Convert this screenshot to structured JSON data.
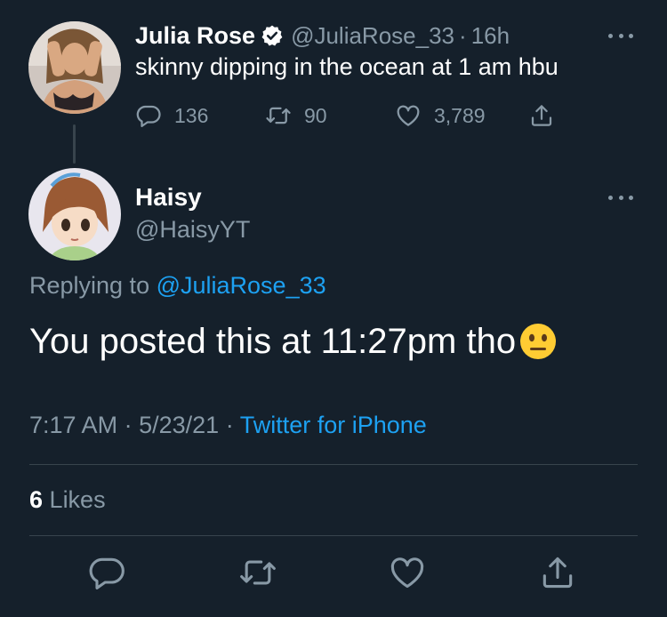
{
  "original_tweet": {
    "name": "Julia Rose",
    "handle": "@JuliaRose_33",
    "separator": "·",
    "time": "16h",
    "text": "skinny dipping in the ocean at 1 am hbu",
    "reply_count": "136",
    "retweet_count": "90",
    "like_count": "3,789",
    "verified_icon": "verified-badge-icon"
  },
  "reply_tweet": {
    "name": "Haisy",
    "handle": "@HaisyYT",
    "replying_prefix": "Replying to",
    "replying_mention": "@JuliaRose_33",
    "text": "You posted this at 11:27pm tho",
    "emoji": "neutral-face-emoji",
    "timestamp": "7:17 AM",
    "separator": "·",
    "date": "5/23/21",
    "source": "Twitter for iPhone",
    "likes_count": "6",
    "likes_label": "Likes"
  },
  "colors": {
    "background": "#15202b",
    "text_primary": "#ffffff",
    "text_secondary": "#8899a6",
    "accent": "#1da1f2",
    "divider": "#38444d"
  },
  "icons": {
    "reply": "reply-icon",
    "retweet": "retweet-icon",
    "like": "heart-icon",
    "share": "share-icon",
    "more": "more-icon"
  }
}
